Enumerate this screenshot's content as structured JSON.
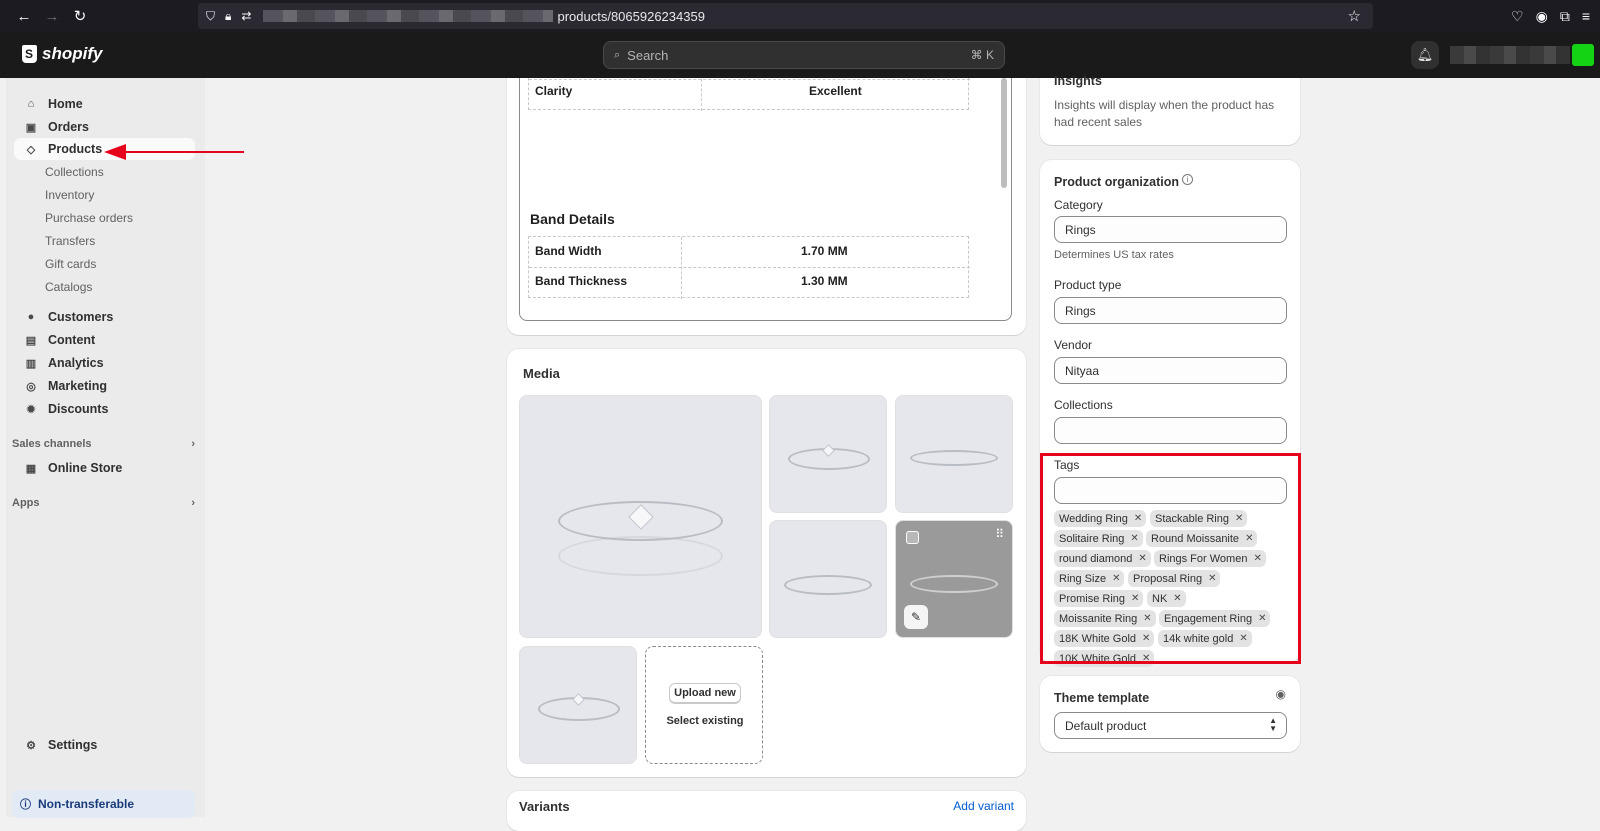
{
  "browser": {
    "url_suffix": "products/8065926234359"
  },
  "topbar": {
    "brand": "shopify",
    "search_placeholder": "Search",
    "search_shortcut": "⌘ K"
  },
  "sidebar": {
    "items": [
      {
        "label": "Home",
        "icon": "home-icon"
      },
      {
        "label": "Orders",
        "icon": "inbox-icon"
      },
      {
        "label": "Products",
        "icon": "tag-icon"
      }
    ],
    "product_subitems": [
      "Collections",
      "Inventory",
      "Purchase orders",
      "Transfers",
      "Gift cards",
      "Catalogs"
    ],
    "items2": [
      {
        "label": "Customers",
        "icon": "person-icon"
      },
      {
        "label": "Content",
        "icon": "content-icon"
      },
      {
        "label": "Analytics",
        "icon": "bar-chart-icon"
      },
      {
        "label": "Marketing",
        "icon": "target-icon"
      },
      {
        "label": "Discounts",
        "icon": "discount-icon"
      }
    ],
    "sales_channels_label": "Sales channels",
    "online_store_label": "Online Store",
    "apps_label": "Apps",
    "settings_label": "Settings",
    "plan_label": "Non-transferable"
  },
  "description": {
    "clarity_label": "Clarity",
    "clarity_value": "Excellent",
    "band_title": "Band Details",
    "band_width_label": "Band Width",
    "band_width_value": "1.70 MM",
    "band_thickness_label": "Band Thickness",
    "band_thickness_value": "1.30 MM"
  },
  "media": {
    "title": "Media",
    "upload_label": "Upload new",
    "select_existing_label": "Select existing"
  },
  "variants": {
    "title": "Variants",
    "add_label": "Add variant"
  },
  "insights": {
    "title": "Insights",
    "text": "Insights will display when the product has had recent sales"
  },
  "organization": {
    "title": "Product organization",
    "category_label": "Category",
    "category_value": "Rings",
    "category_help": "Determines US tax rates",
    "product_type_label": "Product type",
    "product_type_value": "Rings",
    "vendor_label": "Vendor",
    "vendor_value": "Nityaa",
    "collections_label": "Collections",
    "collections_value": "",
    "tags_label": "Tags",
    "tags_value": "",
    "tags": [
      "Wedding Ring",
      "Stackable Ring",
      "Solitaire Ring",
      "Round Moissanite",
      "round diamond",
      "Rings For Women",
      "Ring Size",
      "Proposal Ring",
      "Promise Ring",
      "NK",
      "Moissanite Ring",
      "Engagement Ring",
      "18K White Gold",
      "14k white gold",
      "10K White Gold"
    ]
  },
  "theme": {
    "title": "Theme template",
    "value": "Default product"
  },
  "colors": {
    "annotation_red": "#e5041c",
    "link_blue": "#005bd3",
    "avatar_green": "#14d314"
  }
}
